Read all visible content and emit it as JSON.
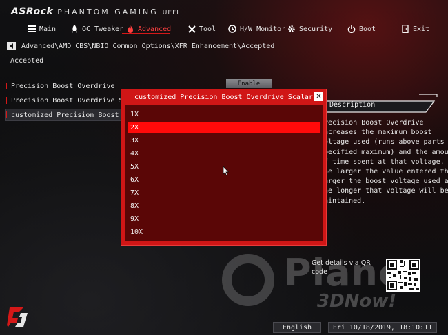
{
  "header": {
    "brand_asrock": "ASRock",
    "brand_phantom": "PHANTOM GAMING",
    "brand_uefi": "UEFI"
  },
  "nav": {
    "main": "Main",
    "oc_tweaker": "OC Tweaker",
    "advanced": "Advanced",
    "tool": "Tool",
    "hw_monitor": "H/W Monitor",
    "security": "Security",
    "boot": "Boot",
    "exit": "Exit",
    "active": "Advanced"
  },
  "breadcrumb": "Advanced\\AMD CBS\\NBIO Common Options\\XFR Enhancement\\Accepted",
  "section_label": "Accepted",
  "options": [
    {
      "label": "Precision Boost Overdrive"
    },
    {
      "label": "Precision Boost Overdrive Scalar"
    },
    {
      "label": "customized Precision Boost Overdrive Scalar"
    }
  ],
  "enable_value": "Enable",
  "description": {
    "title": "Description",
    "lines": [
      "Precision Boost Overdrive",
      "increases the maximum boost",
      "voltage used (runs above parts",
      "specified maximum) and the amount",
      "of time spent at that voltage.",
      "The larger the value entered the",
      "larger the boost voltage used and",
      "the longer that voltage will be",
      "maintained."
    ]
  },
  "modal": {
    "title": "customized Precision Boost Overdrive Scalar",
    "close": "✕",
    "items": [
      "1X",
      "2X",
      "3X",
      "4X",
      "5X",
      "6X",
      "7X",
      "8X",
      "9X",
      "10X"
    ],
    "selected_index": 1
  },
  "qr": {
    "label": "Get details via QR code"
  },
  "watermark": {
    "text": "Plane",
    "sub": "3DNow!"
  },
  "footer": {
    "language": "English",
    "datetime": "Fri 10/18/2019, 18:10:11"
  },
  "colors": {
    "accent_red": "#d41818",
    "modal_red": "#d01616",
    "modal_body": "#5a0606",
    "selection_red": "#ff0a0a"
  },
  "icons": {
    "main": "list-icon",
    "oc_tweaker": "rocket-icon",
    "advanced": "flame-icon",
    "tool": "tools-icon",
    "hw_monitor": "monitor-icon",
    "security": "gear-shield-icon",
    "boot": "power-icon",
    "exit": "exit-door-icon"
  }
}
